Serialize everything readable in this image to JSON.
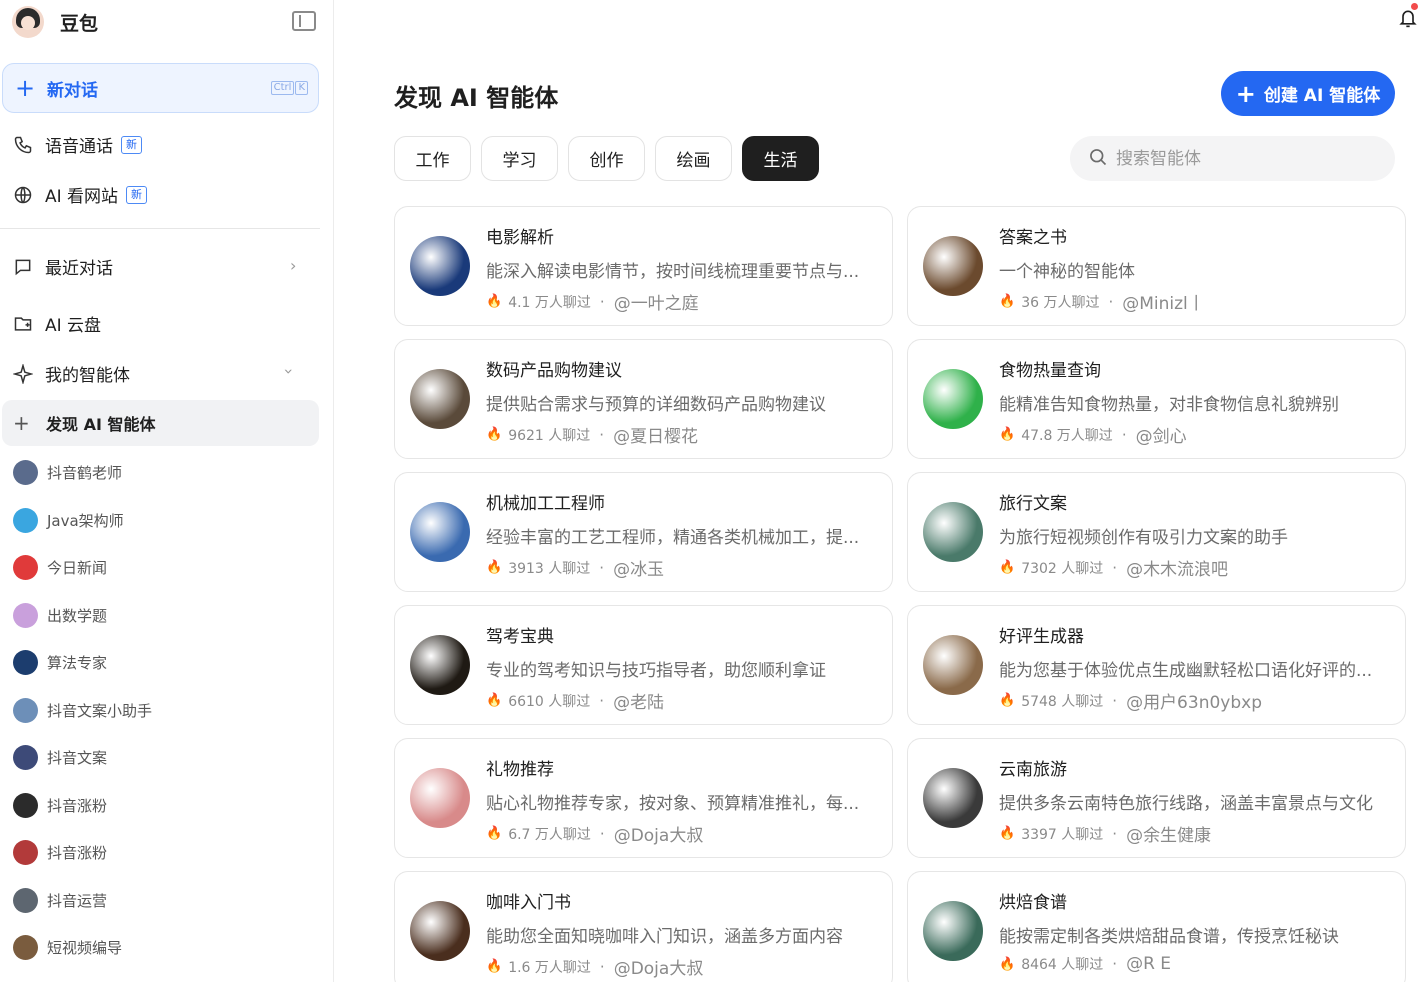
{
  "sidebar": {
    "brand": "豆包",
    "new_chat": {
      "label": "新对话",
      "shortcut": [
        "Ctrl",
        "K"
      ]
    },
    "features": [
      {
        "label": "语音通话",
        "tag": "新",
        "icon": "phone-icon"
      },
      {
        "label": "AI 看网站",
        "tag": "新",
        "icon": "globe-icon"
      }
    ],
    "nav": [
      {
        "label": "最近对话",
        "icon": "chat-icon"
      },
      {
        "label": "AI 云盘",
        "icon": "cloud-drive-icon"
      },
      {
        "label": "我的智能体",
        "icon": "sparkle-icon"
      }
    ],
    "discover": "发现 AI 智能体",
    "agents": [
      {
        "name": "抖音鹤老师",
        "color": "#5a6b8c"
      },
      {
        "name": "Java架构师",
        "color": "#3aa6e0"
      },
      {
        "name": "今日新闻",
        "color": "#e03a3a"
      },
      {
        "name": "出数学题",
        "color": "#c9a0dc"
      },
      {
        "name": "算法专家",
        "color": "#1c3d6e"
      },
      {
        "name": "抖音文案小助手",
        "color": "#6d8fb8"
      },
      {
        "name": "抖音文案",
        "color": "#3d4a78"
      },
      {
        "name": "抖音涨粉",
        "color": "#2b2b2b"
      },
      {
        "name": "抖音涨粉",
        "color": "#b23a3a"
      },
      {
        "name": "抖音运营",
        "color": "#5d6670"
      },
      {
        "name": "短视频编导",
        "color": "#7a5c3e"
      }
    ]
  },
  "main": {
    "title": "发现 AI 智能体",
    "create_button": "创建 AI 智能体",
    "tabs": [
      "工作",
      "学习",
      "创作",
      "绘画",
      "生活"
    ],
    "active_tab": "生活",
    "search_placeholder": "搜索智能体",
    "cards": [
      {
        "title": "电影解析",
        "desc": "能深入解读电影情节，按时间线梳理重要节点与...",
        "stat": "4.1 万人聊过",
        "author": "@一叶之庭",
        "color": "#1a3a7a"
      },
      {
        "title": "答案之书",
        "desc": "一个神秘的智能体",
        "stat": "36 万人聊过",
        "author": "@Minizl丨",
        "color": "#6b4a2e"
      },
      {
        "title": "数码产品购物建议",
        "desc": "提供贴合需求与预算的详细数码产品购物建议",
        "stat": "9621 人聊过",
        "author": "@夏日樱花",
        "color": "#5a4a3a"
      },
      {
        "title": "食物热量查询",
        "desc": "能精准告知食物热量，对非食物信息礼貌辨别",
        "stat": "47.8 万人聊过",
        "author": "@剑心",
        "color": "#2fb14a"
      },
      {
        "title": "机械加工工程师",
        "desc": "经验丰富的工艺工程师，精通各类机械加工，提...",
        "stat": "3913 人聊过",
        "author": "@冰玉",
        "color": "#3a6ab0"
      },
      {
        "title": "旅行文案",
        "desc": "为旅行短视频创作有吸引力文案的助手",
        "stat": "7302 人聊过",
        "author": "@木木流浪吧",
        "color": "#4a7a6a"
      },
      {
        "title": "驾考宝典",
        "desc": "专业的驾考知识与技巧指导者，助您顺利拿证",
        "stat": "6610 人聊过",
        "author": "@老陆",
        "color": "#1f1a14"
      },
      {
        "title": "好评生成器",
        "desc": "能为您基于体验优点生成幽默轻松口语化好评的...",
        "stat": "5748 人聊过",
        "author": "@用户63n0ybxp",
        "color": "#8a6a4a"
      },
      {
        "title": "礼物推荐",
        "desc": "贴心礼物推荐专家，按对象、预算精准推礼，每...",
        "stat": "6.7 万人聊过",
        "author": "@Doja大叔",
        "color": "#d88a8a"
      },
      {
        "title": "云南旅游",
        "desc": "提供多条云南特色旅行线路，涵盖丰富景点与文化",
        "stat": "3397 人聊过",
        "author": "@余生健康",
        "color": "#3a3a3a"
      },
      {
        "title": "咖啡入门书",
        "desc": "能助您全面知晓咖啡入门知识，涵盖多方面内容",
        "stat": "1.6 万人聊过",
        "author": "@Doja大叔",
        "color": "#4a2e1e"
      },
      {
        "title": "烘焙食谱",
        "desc": "能按需定制各类烘焙甜品食谱，传授烹饪秘诀",
        "stat": "8464 人聊过",
        "author": "@R E",
        "color": "#3a6a5a"
      }
    ]
  }
}
